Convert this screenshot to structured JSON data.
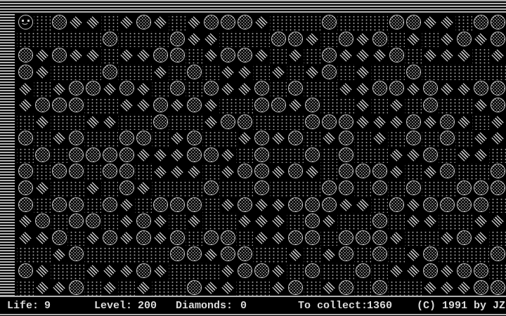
{
  "status_bar": {
    "life_label": "Life:",
    "life_value": "9",
    "level_label": "Level:",
    "level_value": "200",
    "diamonds_label": "Diamonds:",
    "diamonds_value": "0",
    "collect_label": "To collect:",
    "collect_value": "1360",
    "copyright": "(C) 1991 by JZ"
  },
  "field": {
    "rows": 17,
    "cols": 29,
    "legend": {
      ".": "dirt",
      "O": "boulder",
      "*": "diamond",
      "P": "player",
      " ": "empty"
    },
    "grid": [
      "P.O**.*O*.*OOO*...O...OO**.OO",
      ".....O...O**...OO*.O*O.*.*O*O",
      "O*O**.**OO.*OO*.*.O***O.***.*",
      "O*...O..*.O.**.*.*O.*..O.....",
      "*.*OO*O*.O.O**O.O..**OO*O**OO",
      "*OOO..**O*O*..OO*O..*.*.O..*O",
      ".*..**..O..*OO...OOO***O*O*.*",
      "O.*O..OO.*O..*O*O.*O.*.O.O.**",
      ".O.OOOO***OO*.O..O.O..**O.**.",
      "O.OO.OO.***.*OO*O*.OOO*.*O..O",
      "O*..*.O*...O..O...OO.O.O..OOO",
      "O.OO.O*.OOO.*O**OOO**.O*OOOO.",
      "*O.OO.*O*.*..***.O*..O.**..**",
      "**O.*O*O*O.OO.**OO.OOO*..*O*.",
      "..*O.....OO*OO..*.*O.O.*O...O",
      "O*..***O*...*OO*.O..O.**O*OO.",
      ".**O.*.*..O**..*O.*O.O..***OO"
    ]
  },
  "colors": {
    "background": "#000000",
    "wall_stripe": "#b2b2b2",
    "dirt_dot": "#9e9e9e",
    "stone_outline": "#c8c8c8",
    "stone_dot": "#c4c4c4",
    "diamond_stripe": "#c6c6c6",
    "status_text": "#dcdcdc"
  }
}
